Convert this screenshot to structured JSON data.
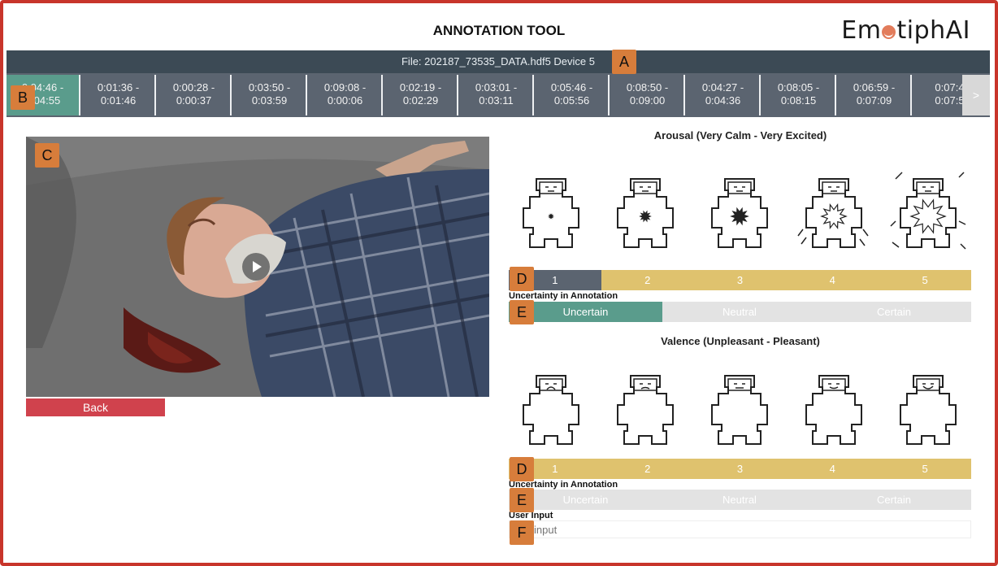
{
  "app": {
    "title": "ANNOTATION TOOL",
    "logo_text_left": "Em",
    "logo_text_right": "tiphAI"
  },
  "file_bar": {
    "text": "File: 202187_73535_DATA.hdf5 Device 5"
  },
  "segments": [
    {
      "line1": "0:04:46 -",
      "line2": "0:04:55",
      "active": true
    },
    {
      "line1": "0:01:36 -",
      "line2": "0:01:46"
    },
    {
      "line1": "0:00:28 -",
      "line2": "0:00:37"
    },
    {
      "line1": "0:03:50 -",
      "line2": "0:03:59"
    },
    {
      "line1": "0:09:08 -",
      "line2": "0:00:06"
    },
    {
      "line1": "0:02:19 -",
      "line2": "0:02:29"
    },
    {
      "line1": "0:03:01 -",
      "line2": "0:03:11"
    },
    {
      "line1": "0:05:46 -",
      "line2": "0:05:56"
    },
    {
      "line1": "0:08:50 -",
      "line2": "0:09:00"
    },
    {
      "line1": "0:04:27 -",
      "line2": "0:04:36"
    },
    {
      "line1": "0:08:05 -",
      "line2": "0:08:15"
    },
    {
      "line1": "0:06:59 -",
      "line2": "0:07:09"
    },
    {
      "line1": "0:07:4",
      "line2": "0:07:5"
    }
  ],
  "segments_next": ">",
  "back_button": "Back",
  "arousal": {
    "title": "Arousal (Very Calm - Very Excited)",
    "scale": [
      "1",
      "2",
      "3",
      "4",
      "5"
    ],
    "selected": "1",
    "uncertainty_label": "Uncertainty in Annotation",
    "uncertainty": [
      "Uncertain",
      "Neutral",
      "Certain"
    ],
    "uncertainty_selected": "Uncertain"
  },
  "valence": {
    "title": "Valence (Unpleasant - Pleasant)",
    "scale": [
      "1",
      "2",
      "3",
      "4",
      "5"
    ],
    "uncertainty_label": "Uncertainty in Annotation",
    "uncertainty": [
      "Uncertain",
      "Neutral",
      "Certain"
    ]
  },
  "user_input": {
    "label": "User Input",
    "placeholder": "input"
  },
  "tags": {
    "A": "A",
    "B": "B",
    "C": "C",
    "D": "D",
    "E": "E",
    "F": "F"
  },
  "colors": {
    "frame": "#c8352b",
    "header_bar": "#3c4a55",
    "segment": "#5b6470",
    "segment_active": "#5a9c8c",
    "scale": "#dfc26e",
    "scale_selected": "#5b6470",
    "uncertainty_selected": "#5a9c8c",
    "back": "#d0424d",
    "tag": "#d77d3b"
  }
}
